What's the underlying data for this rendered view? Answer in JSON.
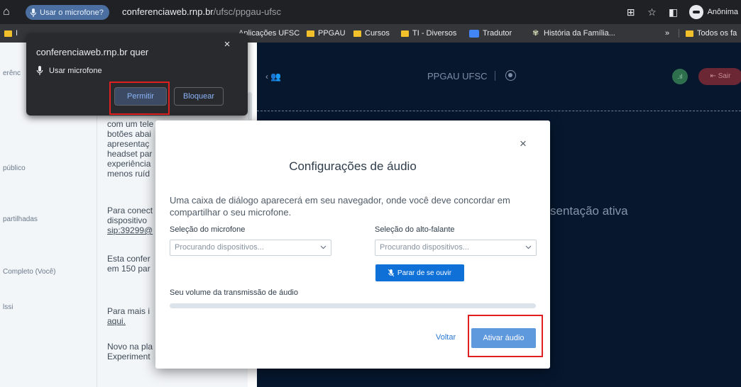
{
  "browser": {
    "mic_chip_label": "Usar o microfone?",
    "url_host": "conferenciaweb.rnp.br",
    "url_path": "/ufsc/ppgau-ufsc",
    "profile_name": "Anônima"
  },
  "bookmarks": {
    "items": [
      {
        "label": "I"
      },
      {
        "label": "Aplicações UFSC"
      },
      {
        "label": "PPGAU"
      },
      {
        "label": "Cursos"
      },
      {
        "label": "TI - Diversos"
      },
      {
        "label": "Tradutor"
      },
      {
        "label": "História da Família..."
      },
      {
        "label": "»"
      },
      {
        "label": "Todos os fa"
      }
    ]
  },
  "permission_popup": {
    "title": "conferenciaweb.rnp.br quer",
    "mic_label": "Usar microfone",
    "allow_label": "Permitir",
    "block_label": "Bloquear"
  },
  "left_panel": {
    "items": [
      {
        "label": "erênc"
      },
      {
        "label": "público"
      },
      {
        "label": "partilhadas"
      },
      {
        "label": "Completo (Você)"
      },
      {
        "label": "lssi"
      }
    ]
  },
  "chat": {
    "lines": [
      "com um tele",
      "botões abai",
      "apresentaç",
      "headset par",
      "experiência",
      "menos ruíd",
      "Para conect",
      "dispositivo",
      "sip:39299@",
      "Esta confer",
      "em 150 par",
      "Para mais i",
      "aqui.",
      "Novo na pla",
      "Experiment"
    ]
  },
  "main": {
    "room_title": "PPGAU UFSC",
    "exit_label": "Sair",
    "presentation_text": "sentação ativa"
  },
  "modal": {
    "title": "Configurações de áudio",
    "description": "Uma caixa de diálogo aparecerá em seu navegador, onde você deve concordar em compartilhar o seu microfone.",
    "mic_label": "Seleção do microfone",
    "mic_value": "Procurando dispositivos...",
    "speaker_label": "Seleção do alto-falante",
    "speaker_value": "Procurando dispositivos...",
    "stop_listen_label": "Parar de se ouvir",
    "volume_label": "Seu volume da transmissão de áudio",
    "volume_level": 0,
    "back_label": "Voltar",
    "activate_label": "Ativar áudio"
  },
  "colors": {
    "highlight": "#e02020",
    "primary_button": "#0f70d7",
    "activate_button": "#5e98dd"
  }
}
